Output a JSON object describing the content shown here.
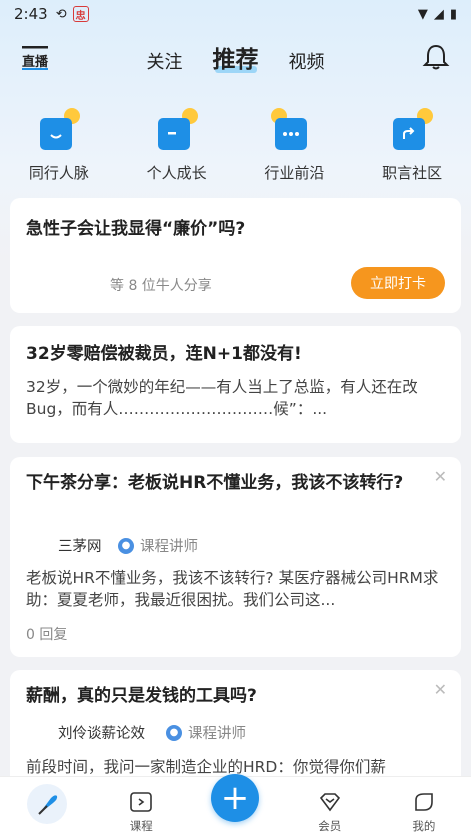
{
  "status_bar": {
    "time": "2:43",
    "badge": "忠"
  },
  "top_nav": {
    "logo": "直播",
    "tabs": [
      {
        "label": "关注",
        "active": false
      },
      {
        "label": "推荐",
        "active": true
      },
      {
        "label": "视频",
        "active": false
      }
    ]
  },
  "quick_entries": [
    {
      "label": "同行人脉",
      "icon": "smile-icon"
    },
    {
      "label": "个人成长",
      "icon": "growth-icon"
    },
    {
      "label": "行业前沿",
      "icon": "chat-icon"
    },
    {
      "label": "职言社区",
      "icon": "share-icon"
    }
  ],
  "checkin_card": {
    "question": "急性子会让我显得“廉价”吗?",
    "share_text": "等 8 位牛人分享",
    "button_label": "立即打卡"
  },
  "feed": [
    {
      "title": "32岁零赔偿被裁员，连N+1都没有!",
      "body": "32岁，一个微妙的年纪——有人当上了总监，有人还在改Bug，而有人…………………………候”：..."
    },
    {
      "title": "下午茶分享：老板说HR不懂业务，我该不该转行?",
      "author": "三茅网",
      "tag": "课程讲师",
      "body": "老板说HR不懂业务，我该不该转行? 某医疗器械公司HRM求助：夏夏老师，我最近很困扰。我们公司这...",
      "replies": "0 回复"
    },
    {
      "title": "薪酬，真的只是发钱的工具吗?",
      "author": "刘伶谈薪论效",
      "tag": "课程讲师",
      "body": "前段时间，我问一家制造企业的HRD：你觉得你们薪"
    }
  ],
  "bottom_nav": [
    {
      "label": "",
      "icon": "home-feather-icon"
    },
    {
      "label": "课程",
      "icon": "course-icon"
    },
    {
      "label": "",
      "icon": "plus-icon"
    },
    {
      "label": "会员",
      "icon": "vip-icon"
    },
    {
      "label": "我的",
      "icon": "profile-icon"
    }
  ],
  "colors": {
    "accent": "#1e8fe6",
    "orange": "#f6961e",
    "dot": "#ffc93c"
  }
}
